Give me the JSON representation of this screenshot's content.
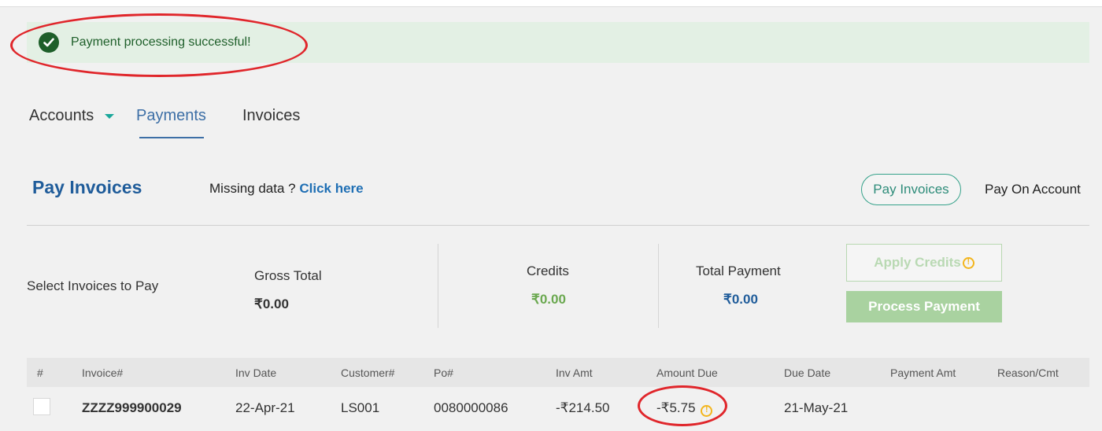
{
  "alert": {
    "message": "Payment processing successful!"
  },
  "tabs": [
    {
      "label": "Accounts"
    },
    {
      "label": "Payments"
    },
    {
      "label": "Invoices"
    }
  ],
  "section": {
    "title": "Pay Invoices",
    "missing_prefix": "Missing data ?",
    "missing_link": "Click here",
    "pay_invoices_button": "Pay Invoices",
    "pay_on_account": "Pay On Account"
  },
  "summary": {
    "select_label": "Select Invoices to Pay",
    "gross_total_label": "Gross Total",
    "gross_total_value": "₹0.00",
    "credits_label": "Credits",
    "credits_value": "₹0.00",
    "total_payment_label": "Total Payment",
    "total_payment_value": "₹0.00",
    "apply_credits_label": "Apply Credits",
    "process_payment_label": "Process Payment"
  },
  "table": {
    "columns": [
      "#",
      "Invoice#",
      "Inv Date",
      "Customer#",
      "Po#",
      "Inv Amt",
      "Amount Due",
      "Due Date",
      "Payment Amt",
      "Reason/Cmt"
    ],
    "rows": [
      {
        "invoice": "ZZZZ999900029",
        "inv_date": "22-Apr-21",
        "customer": "LS001",
        "po": "0080000086",
        "inv_amt": "-₹214.50",
        "amount_due": "-₹5.75",
        "due_date": "21-May-21"
      }
    ]
  },
  "colors": {
    "success_bg": "#e3f0e4",
    "success_text": "#1e5f2a",
    "primary_blue": "#1f5c9a",
    "teal": "#35a28a",
    "green_btn": "#a9d2a0",
    "annotation_red": "#e0262b",
    "warning": "#f3b51c"
  }
}
